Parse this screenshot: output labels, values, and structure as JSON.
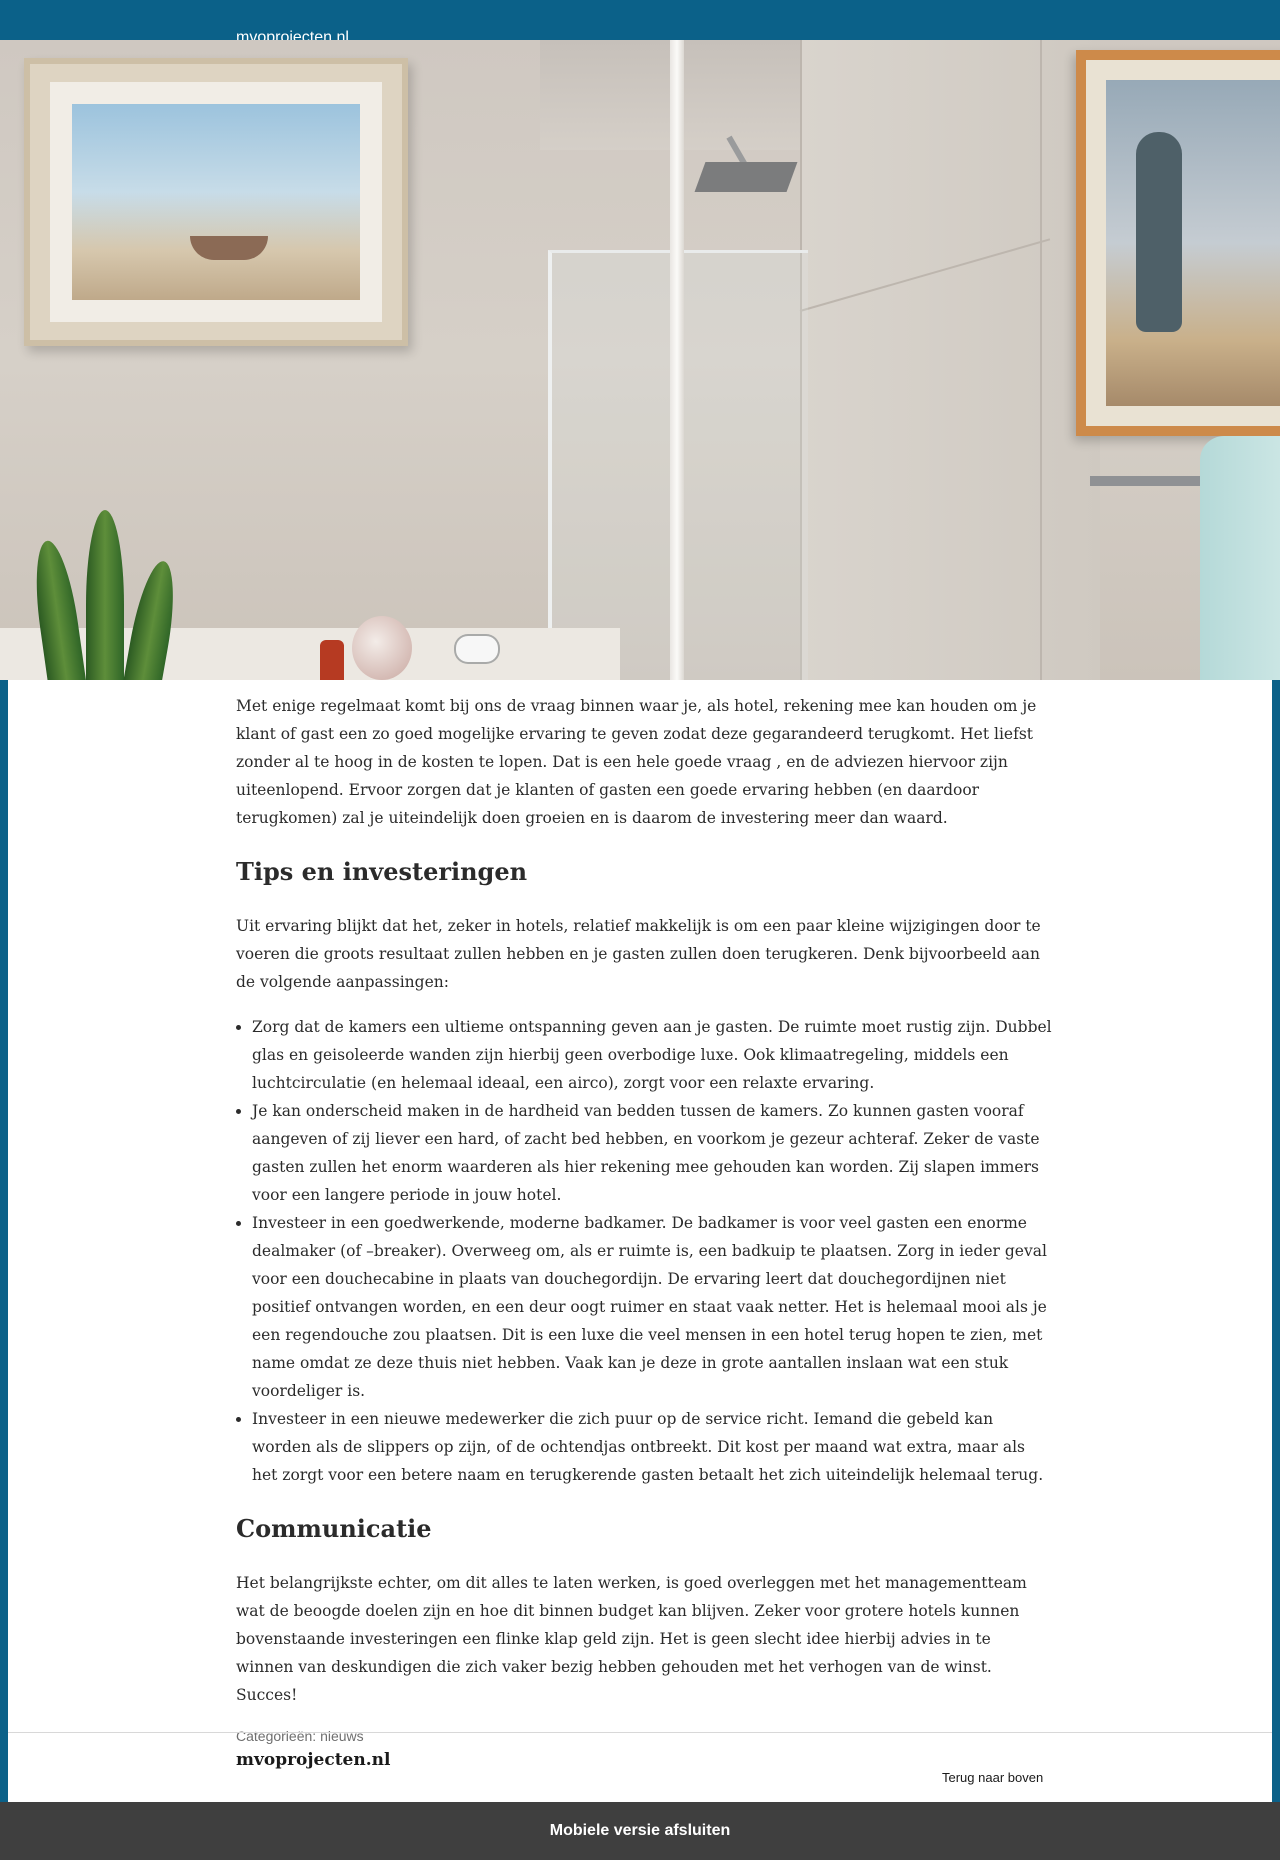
{
  "header": {
    "site_name": "mvoprojecten.nl"
  },
  "hero": {
    "description_icon": "bathroom-photo"
  },
  "article": {
    "intro": "Met enige regelmaat komt bij ons de vraag binnen waar je, als hotel, rekening mee kan houden om je klant of gast een zo goed mogelijke ervaring te geven zodat deze gegarandeerd terugkomt. Het liefst zonder al te hoog in de kosten te lopen. Dat is een hele goede vraag , en de adviezen hiervoor zijn uiteenlopend. Ervoor zorgen dat je klanten of gasten een goede ervaring hebben (en daardoor terugkomen) zal je uiteindelijk doen groeien en is daarom de investering meer dan waard.",
    "heading_tips": "Tips en investeringen",
    "tips_intro": "Uit ervaring blijkt dat het, zeker in hotels, relatief makkelijk is om een paar kleine wijzigingen door te voeren die groots resultaat zullen hebben en je gasten zullen doen terugkeren. Denk bijvoorbeeld aan de volgende aanpassingen:",
    "tips": [
      "Zorg dat de kamers een ultieme ontspanning geven aan je gasten. De ruimte moet rustig zijn. Dubbel glas en geisoleerde wanden zijn hierbij geen overbodige luxe. Ook klimaatregeling, middels een luchtcirculatie (en helemaal ideaal, een airco), zorgt voor een relaxte ervaring.",
      "Je kan onderscheid maken in de hardheid van bedden tussen de kamers. Zo kunnen gasten vooraf aangeven of zij liever een hard, of zacht bed hebben, en voorkom je gezeur achteraf. Zeker de vaste gasten zullen het enorm waarderen als hier rekening mee gehouden kan worden. Zij slapen immers voor een langere periode in jouw hotel.",
      "Investeer in een goedwerkende, moderne badkamer. De badkamer is voor veel gasten een enorme dealmaker (of –breaker). Overweeg om, als er ruimte is, een badkuip te plaatsen. Zorg in ieder geval voor een douchecabine in plaats van douchegordijn. De ervaring leert dat douchegordijnen niet positief ontvangen worden, en een deur oogt ruimer en staat vaak netter. Het is helemaal mooi als je een regendouche zou plaatsen. Dit is een luxe die veel mensen in een hotel terug hopen te zien, met name omdat ze deze thuis niet hebben. Vaak kan je deze in grote aantallen inslaan wat een stuk voordeliger is.",
      "Investeer in een nieuwe medewerker die zich puur op de service richt. Iemand die gebeld kan worden als de slippers op zijn, of de ochtendjas ontbreekt. Dit kost per maand wat extra, maar als het zorgt voor een betere naam en terugkerende gasten betaalt het zich uiteindelijk helemaal terug."
    ],
    "heading_communicatie": "Communicatie",
    "communicatie": "Het belangrijkste echter, om dit alles te laten werken, is goed overleggen met het managementteam wat de beoogde doelen zijn en hoe dit binnen budget kan blijven. Zeker voor grotere hotels kunnen bovenstaande investeringen een flinke klap geld zijn. Het is geen slecht idee hierbij advies in te winnen van deskundigen die zich vaker bezig hebben gehouden met het verhogen van de winst. Succes!",
    "categories_label": "Categorieën: ",
    "category": "nieuws"
  },
  "footer": {
    "site_name": "mvoprojecten.nl",
    "back_to_top": "Terug naar boven"
  },
  "mobile_bar": {
    "label": "Mobiele versie afsluiten"
  }
}
